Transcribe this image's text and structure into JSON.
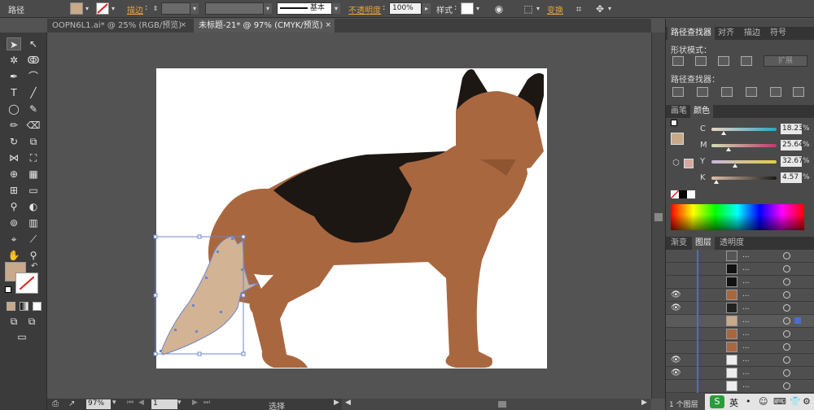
{
  "control_bar": {
    "object_type": "路径",
    "stroke_label": "描边",
    "opacity_label": "不透明度",
    "opacity_value": "100%",
    "stroke_style": "基本",
    "style_label": "样式",
    "transform_label": "变换",
    "fill_color": "#c8a98a"
  },
  "tabs": [
    {
      "label": "OOPN6L1.ai* @ 25% (RGB/预览)",
      "close": "×"
    },
    {
      "label": "未标题-21* @ 97% (CMYK/预览)",
      "close": "×"
    }
  ],
  "status_bar": {
    "zoom": "97%",
    "page": "1",
    "tool_name": "选择"
  },
  "pathfinder_panel": {
    "tabs": [
      "路径查找器",
      "对齐",
      "描边",
      "符号"
    ],
    "shape_modes_label": "形状模式：",
    "expand_button": "扩展",
    "pathfinders_label": "路径查找器："
  },
  "color_panel": {
    "tabs": [
      "画笔",
      "颜色"
    ],
    "channels": [
      {
        "name": "C",
        "value": "18.23",
        "unit": "%"
      },
      {
        "name": "M",
        "value": "25.64",
        "unit": "%"
      },
      {
        "name": "Y",
        "value": "32.67",
        "unit": "%"
      },
      {
        "name": "K",
        "value": "4.57",
        "unit": "%"
      }
    ],
    "fill_color": "#c8a98a",
    "stroke_color": "#d8a7a0"
  },
  "layers_panel": {
    "tabs": [
      "渐变",
      "图层",
      "透明度"
    ],
    "rows": [
      {
        "dots": "...",
        "visible": false,
        "thumb_color": "#555"
      },
      {
        "dots": "...",
        "visible": false,
        "thumb_color": "#111"
      },
      {
        "dots": "...",
        "visible": false,
        "thumb_color": "#111"
      },
      {
        "dots": "...",
        "visible": true,
        "thumb_color": "#a9673f"
      },
      {
        "dots": "...",
        "visible": true,
        "thumb_color": "#222"
      },
      {
        "dots": "...",
        "visible": false,
        "thumb_color": "#c8a98a"
      },
      {
        "dots": "...",
        "visible": false,
        "thumb_color": "#a9673f"
      },
      {
        "dots": "...",
        "visible": false,
        "thumb_color": "#a9673f"
      },
      {
        "dots": "...",
        "visible": true,
        "thumb_color": "#eee"
      },
      {
        "dots": "...",
        "visible": true,
        "thumb_color": "#eee"
      },
      {
        "dots": "...",
        "visible": false,
        "thumb_color": "#eee"
      }
    ],
    "footer": "1 个图层"
  },
  "taskbar": {
    "ime": "英"
  },
  "artwork": {
    "body_color": "#a9673f",
    "saddle_color": "#1d1713",
    "tail_fill": "#d2b394",
    "selection_color": "#6f86c9"
  }
}
